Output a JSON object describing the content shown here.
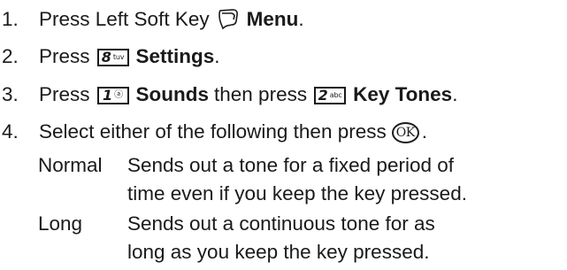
{
  "steps": [
    {
      "num": "1.",
      "text_before": "Press Left Soft Key",
      "label": "Menu",
      "after": "."
    },
    {
      "num": "2.",
      "text_before": "Press",
      "key_big": "8",
      "key_small": "tuv",
      "label": "Settings",
      "after": "."
    },
    {
      "num": "3.",
      "text_before": "Press",
      "key1_big": "1",
      "key1_small": "ⓐ",
      "label1": "Sounds",
      "mid": "then press",
      "key2_big": "2",
      "key2_small": "abc",
      "label2": "Key Tones",
      "after": "."
    },
    {
      "num": "4.",
      "text_before": "Select either of the following then press",
      "ok_label": "OK",
      "after": "."
    }
  ],
  "options": [
    {
      "term": "Normal",
      "desc_line1": "Sends out a tone for a fixed period of",
      "desc_line2": "time even if you keep the key pressed."
    },
    {
      "term": "Long",
      "desc_line1": "Sends out a continuous tone for as",
      "desc_line2": "long as you keep the key pressed."
    }
  ]
}
